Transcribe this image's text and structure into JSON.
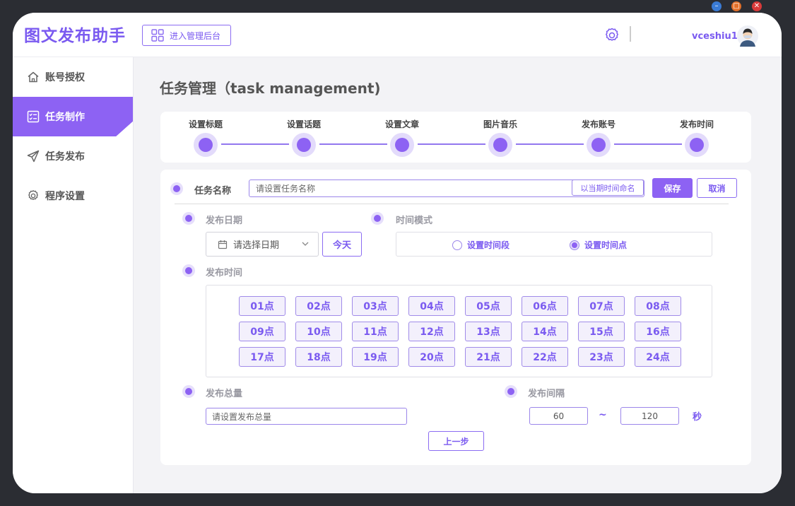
{
  "window": {
    "minimize_icon": "minimize-icon",
    "maximize_icon": "maximize-icon",
    "close_icon": "close-icon"
  },
  "header": {
    "brand": "图文发布助手",
    "admin_button": "进入管理后台",
    "username": "vceshiu1"
  },
  "sidebar": {
    "items": [
      {
        "label": "账号授权",
        "icon": "home-icon"
      },
      {
        "label": "任务制作",
        "icon": "checklist-icon",
        "active": true
      },
      {
        "label": "任务发布",
        "icon": "send-icon"
      },
      {
        "label": "程序设置",
        "icon": "gear-icon"
      }
    ]
  },
  "main": {
    "title": "任务管理（task management)",
    "steps": [
      "设置标题",
      "设置话题",
      "设置文章",
      "图片音乐",
      "发布账号",
      "发布时间"
    ],
    "form": {
      "task_name_label": "任务名称",
      "task_name_placeholder": "请设置任务名称",
      "name_by_time": "以当期时间命名",
      "save": "保存",
      "cancel": "取消",
      "publish_date_label": "发布日期",
      "date_placeholder": "请选择日期",
      "today": "今天",
      "time_mode_label": "时间模式",
      "mode_range": "设置时间段",
      "mode_point": "设置时间点",
      "publish_time_label": "发布时间",
      "hours": [
        "01点",
        "02点",
        "03点",
        "04点",
        "05点",
        "06点",
        "07点",
        "08点",
        "09点",
        "10点",
        "11点",
        "12点",
        "13点",
        "14点",
        "15点",
        "16点",
        "17点",
        "18点",
        "19点",
        "20点",
        "21点",
        "22点",
        "23点",
        "24点"
      ],
      "total_label": "发布总量",
      "total_placeholder": "请设置发布总量",
      "interval_label": "发布间隔",
      "interval_min": "60",
      "interval_sep": "~",
      "interval_max": "120",
      "interval_unit": "秒",
      "prev": "上一步"
    }
  },
  "colors": {
    "accent": "#8d62f3",
    "brand": "#7a5af0"
  }
}
